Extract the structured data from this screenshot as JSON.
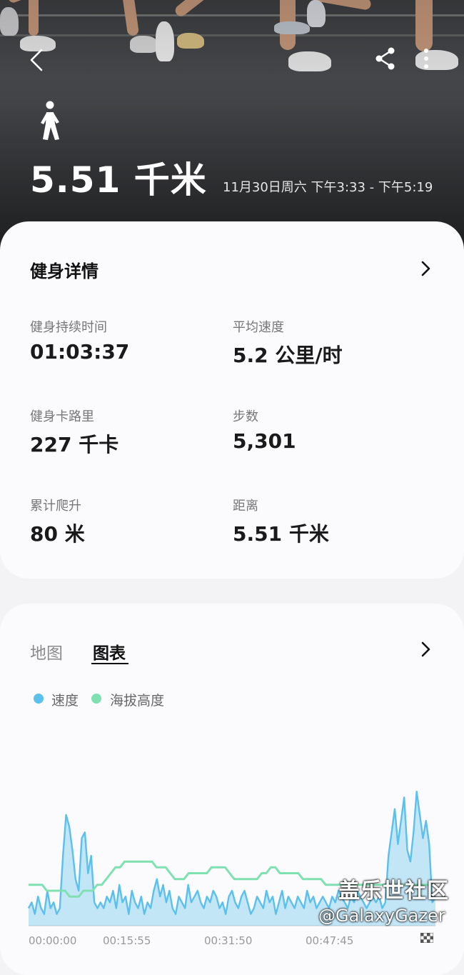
{
  "header": {
    "distance": "5.51 千米",
    "time_range": "11月30日周六 下午3:33 - 下午5:19"
  },
  "details": {
    "title": "健身详情",
    "stats": [
      {
        "label": "健身持续时间",
        "value": "01:03:37"
      },
      {
        "label": "平均速度",
        "value": "5.2 公里/时"
      },
      {
        "label": "健身卡路里",
        "value": "227 千卡"
      },
      {
        "label": "步数",
        "value": "5,301"
      },
      {
        "label": "累计爬升",
        "value": "80 米"
      },
      {
        "label": "距离",
        "value": "5.51 千米"
      }
    ]
  },
  "chart_section": {
    "tabs": [
      {
        "label": "地图",
        "selected": false
      },
      {
        "label": "图表",
        "selected": true
      }
    ],
    "legend": [
      {
        "label": "速度",
        "color": "#5bc0eb"
      },
      {
        "label": "海拔高度",
        "color": "#7fe0b0"
      }
    ]
  },
  "chart_data": {
    "type": "area",
    "x_ticks": [
      "00:00:00",
      "00:15:55",
      "00:31:50",
      "00:47:45"
    ],
    "series": [
      {
        "name": "速度",
        "values": [
          3,
          4,
          2,
          5,
          3,
          2,
          6,
          3,
          4,
          2,
          3,
          12,
          19,
          17,
          13,
          8,
          6,
          15,
          16,
          9,
          12,
          4,
          3,
          4,
          3,
          5,
          4,
          6,
          3,
          7,
          4,
          5,
          2,
          6,
          4,
          3,
          5,
          2,
          4,
          3,
          6,
          8,
          5,
          7,
          4,
          6,
          3,
          2,
          5,
          4,
          3,
          7,
          4,
          5,
          6,
          4,
          3,
          5,
          4,
          6,
          5,
          3,
          4,
          2,
          5,
          6,
          4,
          3,
          5,
          6,
          4,
          2,
          3,
          5,
          4,
          3,
          6,
          4,
          5,
          2,
          4,
          6,
          3,
          5,
          4,
          3,
          5,
          4,
          3,
          6,
          4,
          5,
          3,
          4,
          5,
          4,
          3,
          5,
          4,
          6,
          5,
          4,
          3,
          5,
          4,
          6,
          5,
          4,
          3,
          4,
          5,
          4,
          5,
          3,
          4,
          12,
          16,
          20,
          14,
          18,
          22,
          13,
          11,
          16,
          23,
          19,
          15,
          18,
          14,
          4,
          5
        ]
      },
      {
        "name": "海拔高度",
        "values": [
          7,
          7,
          7,
          7,
          6,
          6,
          6,
          6,
          6,
          5,
          5,
          5,
          6,
          6,
          6,
          7,
          7,
          8,
          9,
          10,
          10,
          11,
          11,
          11,
          11,
          11,
          11,
          11,
          10,
          10,
          10,
          9,
          8,
          8,
          8,
          9,
          9,
          9,
          9,
          9,
          10,
          10,
          10,
          10,
          9,
          8,
          8,
          8,
          8,
          8,
          8,
          9,
          9,
          10,
          10,
          9,
          9,
          9,
          9,
          9,
          8,
          8,
          8,
          8,
          8,
          7,
          7,
          7,
          7,
          7,
          7,
          7,
          7,
          7,
          7,
          7,
          7,
          7,
          7,
          7,
          7,
          7,
          7,
          7,
          7,
          7,
          7,
          7,
          7,
          7
        ]
      }
    ]
  },
  "watermark": {
    "line1": "盖乐世社区",
    "line2": "@GalaxyGazer"
  }
}
